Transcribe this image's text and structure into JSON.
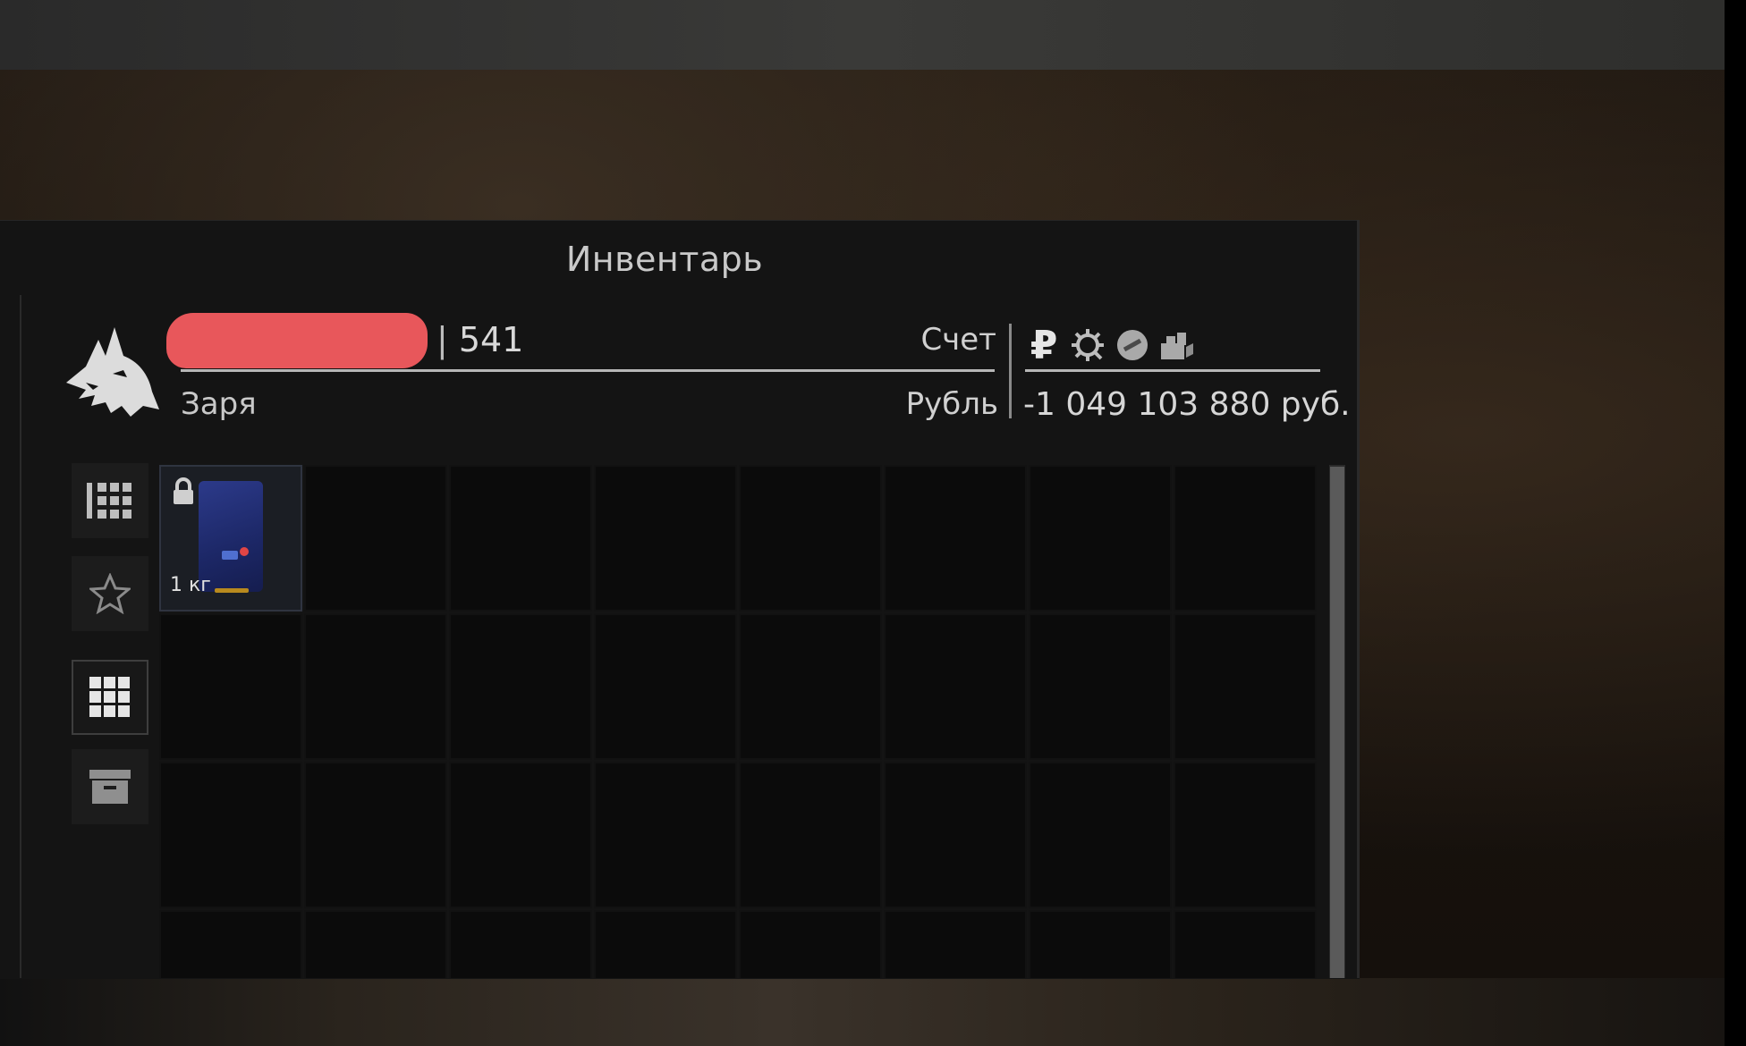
{
  "window": {
    "title": "Инвентарь"
  },
  "player": {
    "name": "",
    "level_prefix": "|",
    "level": "541",
    "faction": "Заря",
    "emblem_icon": "wolf-head-icon"
  },
  "account": {
    "label_account": "Счет",
    "label_currency": "Рубль",
    "balance": "-1 049 103 880 руб.",
    "currency_icons": [
      "ruble-icon",
      "gear-coin-icon",
      "token-icon",
      "cash-stack-icon"
    ],
    "ruble_symbol": "₽"
  },
  "tabs": [
    {
      "icon": "list-grid-icon",
      "active": false
    },
    {
      "icon": "star-icon",
      "active": false
    },
    {
      "icon": "grid-icon",
      "active": true
    },
    {
      "icon": "box-icon",
      "active": false
    }
  ],
  "inventory": {
    "columns": 8,
    "items": [
      {
        "slot": 0,
        "icon": "smartphone-icon",
        "locked": true,
        "weight": "1 кг"
      }
    ]
  },
  "colors": {
    "panel_bg": "#141414",
    "redaction": "#e8575b",
    "item_blue": "#2c3a8a",
    "weight_bar": "#b88a1e"
  }
}
